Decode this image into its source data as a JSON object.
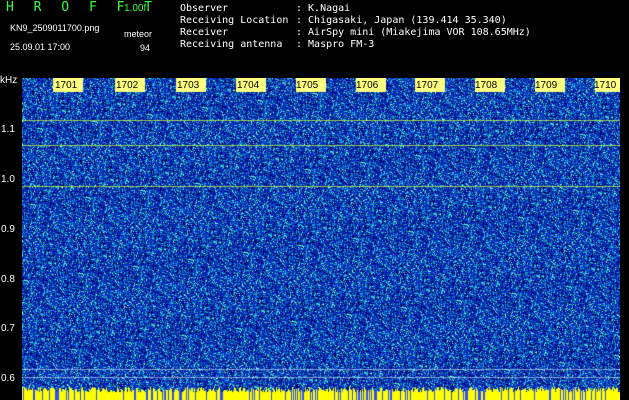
{
  "header": {
    "app_title": "H R O F F T",
    "version": "1.00f",
    "filename": "KN9_2509011700.png",
    "datetime": "25.09.01 17:00",
    "meteor_label": "meteor",
    "meteor_count": "94",
    "info": [
      {
        "label": "Observer",
        "value": ": K.Nagai"
      },
      {
        "label": "Receiving Location",
        "value": ": Chigasaki, Japan (139.414 35.340)"
      },
      {
        "label": "Receiver",
        "value": ": AirSpy mini (Miakejima VOR 108.65MHz)"
      },
      {
        "label": "Receiving antenna",
        "value": ": Maspro FM-3"
      }
    ]
  },
  "plot": {
    "y_unit": "kHz",
    "y_ticks": [
      "1.1",
      "1.0",
      "0.9",
      "0.8",
      "0.7",
      "0.6"
    ],
    "x_ticks": [
      "1701",
      "1702",
      "1703",
      "1704",
      "1705",
      "1706",
      "1707",
      "1708",
      "1709",
      "1710"
    ],
    "colors": {
      "background": "#0a1a8c",
      "noise_high": "#19c8c8",
      "line": "#c8ff3c",
      "bottom_band": "#ffff00"
    }
  }
}
